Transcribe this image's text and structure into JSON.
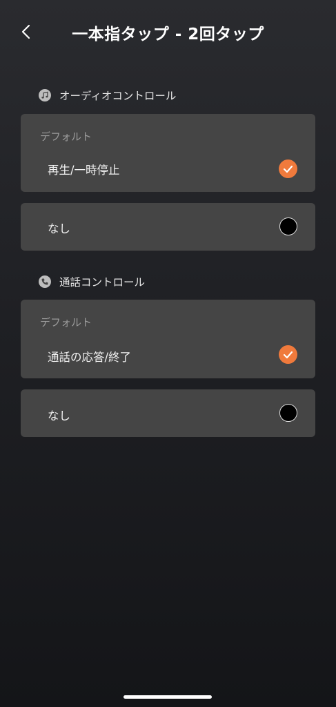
{
  "header": {
    "title": "一本指タップ - 2回タップ",
    "back_icon": "chevron-left-icon"
  },
  "sections": [
    {
      "label": "オーディオコントロール",
      "icon": "music-note-icon",
      "default_label": "デフォルト",
      "options": [
        {
          "label": "再生/一時停止",
          "selected": true
        },
        {
          "label": "なし",
          "selected": false
        }
      ]
    },
    {
      "label": "通話コントロール",
      "icon": "phone-icon",
      "default_label": "デフォルト",
      "options": [
        {
          "label": "通話の応答/終了",
          "selected": true
        },
        {
          "label": "なし",
          "selected": false
        }
      ]
    }
  ],
  "colors": {
    "accent": "#f07a3c",
    "card": "#454545",
    "background_top": "#2a2b2f",
    "background_bottom": "#141518"
  }
}
